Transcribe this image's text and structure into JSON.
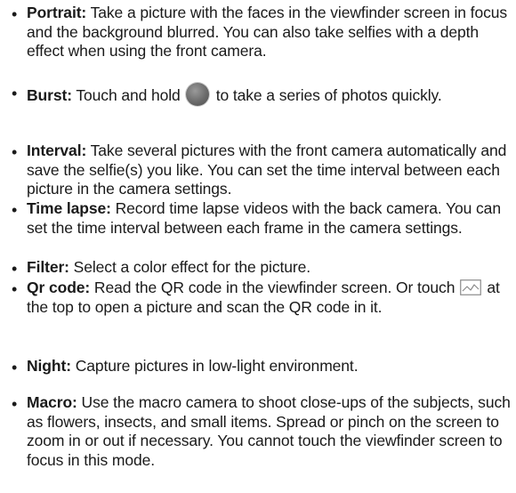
{
  "items": [
    {
      "term": "Portrait:",
      "text": " Take a picture with the faces in the viewfinder screen in focus and the background blurred. You can also take selfies with a depth effect when using the front camera."
    },
    {
      "term": "Burst:",
      "text_before": " Touch and hold",
      "text_after": "to take a series of photos quickly.",
      "icon": "shutter-button-icon"
    },
    {
      "term": "Interval:",
      "text": " Take several pictures with the front camera automatically and save the selfie(s) you like. You can set the time interval between each picture in the camera settings."
    },
    {
      "term": "Time lapse:",
      "text": " Record time lapse videos with the back camera. You can set the time interval between each frame in the camera settings."
    },
    {
      "term": "Filter:",
      "text": " Select a color effect for the picture."
    },
    {
      "term": "Qr code:",
      "text_before": " Read the QR code in the viewfinder screen. Or touch",
      "text_after": "at the top to open a picture and scan the QR code in it.",
      "icon": "gallery-icon"
    },
    {
      "term": "Night:",
      "text": " Capture pictures in low-light environment."
    },
    {
      "term": "Macro:",
      "text": " Use the macro camera to shoot close-ups of the subjects, such as flowers, insects, and small items. Spread or pinch on the screen to zoom in or out if necessary. You cannot touch the viewfinder screen to focus in this mode."
    }
  ]
}
